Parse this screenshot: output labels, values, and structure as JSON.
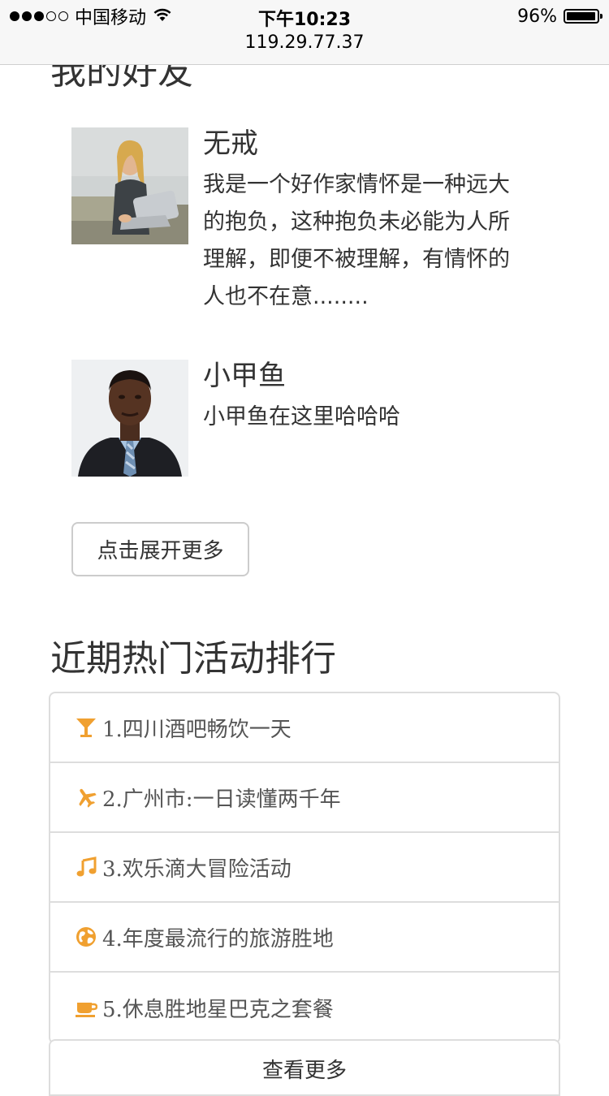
{
  "status_bar": {
    "carrier": "中国移动",
    "time": "下午10:23",
    "battery_percent": "96%",
    "battery_level": 0.96,
    "url": "119.29.77.37"
  },
  "friends_section": {
    "title": "我的好友",
    "friends": [
      {
        "name": "无戒",
        "description": "我是一个好作家情怀是一种远大的抱负，这种抱负未必能为人所理解，即便不被理解，有情怀的人也不在意........"
      },
      {
        "name": "小甲鱼",
        "description": "小甲鱼在这里哈哈哈"
      }
    ],
    "expand_button": "点击展开更多"
  },
  "hot_section": {
    "title": "近期热门活动排行",
    "accent_color": "#f0a030",
    "items": [
      {
        "icon": "cocktail-glass-icon",
        "label": "1.四川酒吧畅饮一天"
      },
      {
        "icon": "plane-icon",
        "label": "2.广州市:一日读懂两千年"
      },
      {
        "icon": "music-note-icon",
        "label": "3.欢乐滴大冒险活动"
      },
      {
        "icon": "globe-icon",
        "label": "4.年度最流行的旅游胜地"
      },
      {
        "icon": "coffee-cup-icon",
        "label": "5.休息胜地星巴克之套餐"
      }
    ],
    "more_button": "查看更多"
  }
}
